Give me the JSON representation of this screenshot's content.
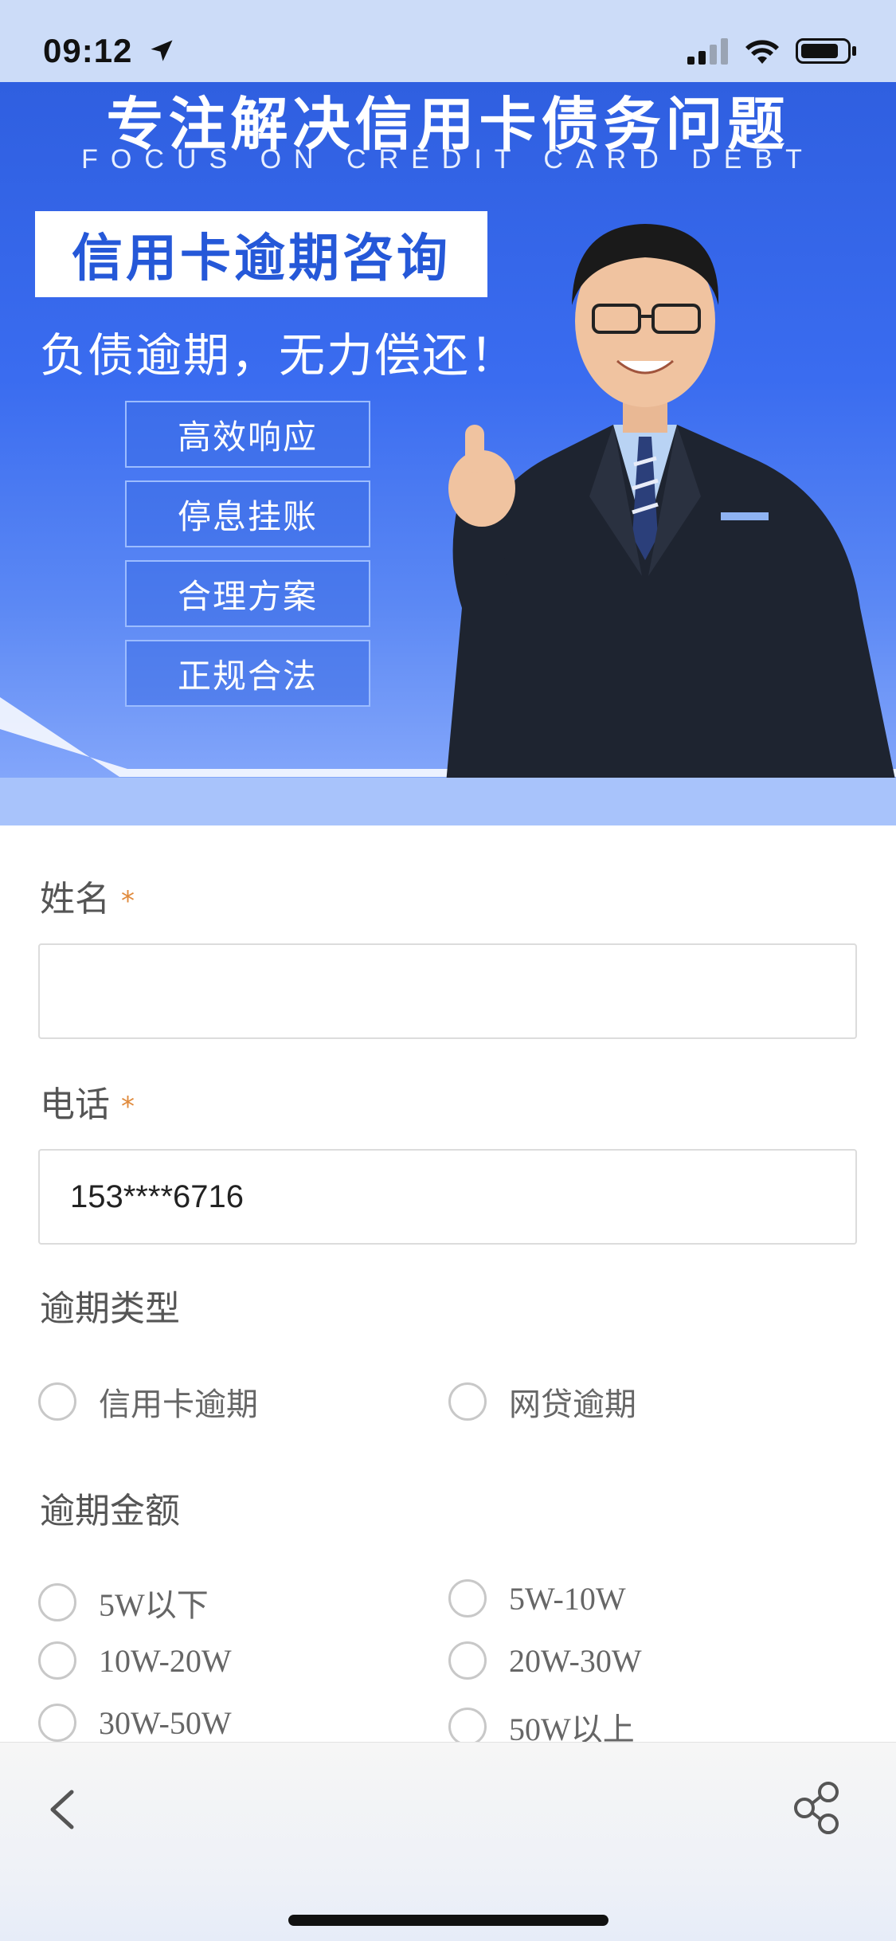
{
  "status_bar": {
    "time": "09:12"
  },
  "banner": {
    "title": "专注解决信用卡债务问题",
    "subtitle": "FOCUS ON CREDIT CARD DEBT",
    "label": "信用卡逾期咨询",
    "tagline": "负债逾期，无力偿还！",
    "features": [
      "高效响应",
      "停息挂账",
      "合理方案",
      "正规合法"
    ]
  },
  "form": {
    "name": {
      "label": "姓名",
      "required_mark": "*",
      "value": ""
    },
    "phone": {
      "label": "电话",
      "required_mark": "*",
      "value": "153****6716"
    },
    "overdue_type": {
      "label": "逾期类型",
      "options": [
        "信用卡逾期",
        "网贷逾期"
      ]
    },
    "overdue_amount": {
      "label": "逾期金额",
      "options": [
        "5W以下",
        "5W-10W",
        "10W-20W",
        "20W-30W",
        "30W-50W",
        "50W以上"
      ]
    }
  },
  "colors": {
    "banner_blue": "#2f5fe0",
    "required_star": "#e08a3c",
    "input_border": "#dcdcdc"
  },
  "icons": {
    "back": "chevron-left-icon",
    "share": "share-icon",
    "location": "location-arrow-icon",
    "signal": "signal-icon",
    "wifi": "wifi-icon",
    "battery": "battery-icon"
  }
}
